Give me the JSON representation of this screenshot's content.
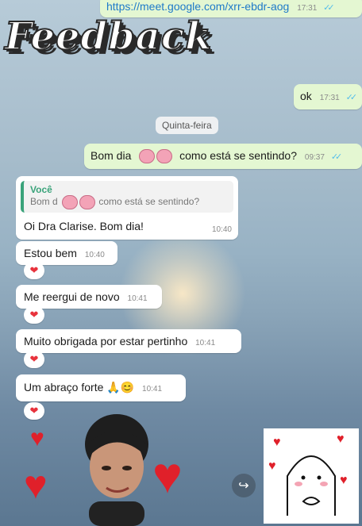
{
  "logo_text": "Feedback",
  "messages": {
    "link": {
      "text": "https://meet.google.com/xrr-ebdr-aog",
      "time": "17:31"
    },
    "ok": {
      "text": "ok",
      "time": "17:31"
    },
    "date_chip": "Quinta-feira",
    "bom_dia": {
      "before": "Bom dia",
      "after": "como está se sentindo?",
      "time": "09:37"
    },
    "reply": {
      "quote_author": "Você",
      "quote_before": "Bom d",
      "quote_after": "como está se sentindo?",
      "text": "Oi Dra Clarise. Bom dia!",
      "time": "10:40"
    },
    "estou_bem": {
      "text": "Estou bem",
      "time": "10:40"
    },
    "reergui": {
      "text": "Me reergui de novo",
      "time": "10:41"
    },
    "obrigada": {
      "text": "Muito obrigada por estar pertinho",
      "time": "10:41"
    },
    "abraco": {
      "text": "Um abraço forte 🙏😊",
      "time": "10:41"
    }
  },
  "reaction": "❤",
  "forward_icon": "↪",
  "colors": {
    "outgoing": "#e4f7d2",
    "incoming": "#ffffff",
    "ticks": "#53bdeb",
    "heart": "#e0202a"
  }
}
